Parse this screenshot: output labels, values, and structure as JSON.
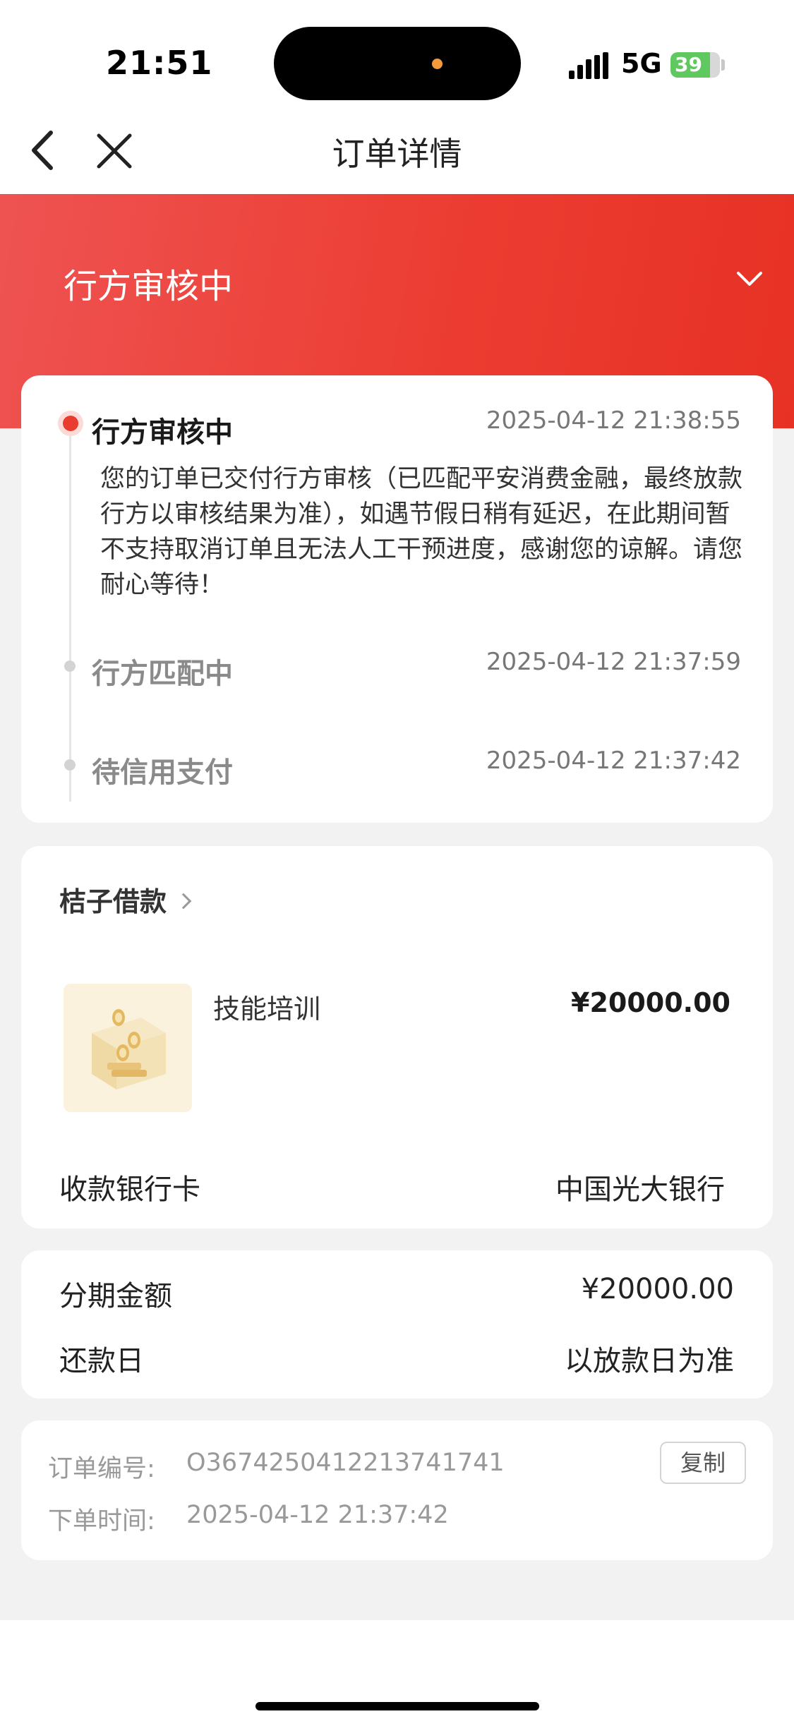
{
  "status_bar": {
    "time": "21:51",
    "network": "5G",
    "battery": "39"
  },
  "nav": {
    "title": "订单详情",
    "back_icon": "chevron-left-icon",
    "close_icon": "close-icon"
  },
  "status": {
    "title": "行方审核中",
    "toggle_icon": "chevron-down-icon"
  },
  "timeline": [
    {
      "label": "行方审核中",
      "time": "2025-04-12 21:38:55",
      "description": "您的订单已交付行方审核（已匹配平安消费金融，最终放款行方以审核结果为准），如遇节假日稍有延迟，在此期间暂不支持取消订单且无法人工干预进度，感谢您的谅解。请您耐心等待！"
    },
    {
      "label": "行方匹配中",
      "time": "2025-04-12 21:37:59"
    },
    {
      "label": "待信用支付",
      "time": "2025-04-12 21:37:42"
    }
  ],
  "product": {
    "merchant": "桔子借款",
    "name": "技能培训",
    "price": "¥20000.00",
    "bank_label": "收款银行卡",
    "bank_value": "中国光大银行"
  },
  "amount": {
    "installment_label": "分期金额",
    "installment_value": "¥20000.00",
    "repay_label": "还款日",
    "repay_value": "以放款日为准"
  },
  "order": {
    "number_label": "订单编号:",
    "number_value": "O3674250412213741741",
    "time_label": "下单时间:",
    "time_value": "2025-04-12 21:37:42",
    "copy_label": "复制"
  },
  "colors": {
    "accent_red": "#e93c2f",
    "banner_gradient_start": "#ee5352",
    "banner_gradient_end": "#e73125"
  }
}
